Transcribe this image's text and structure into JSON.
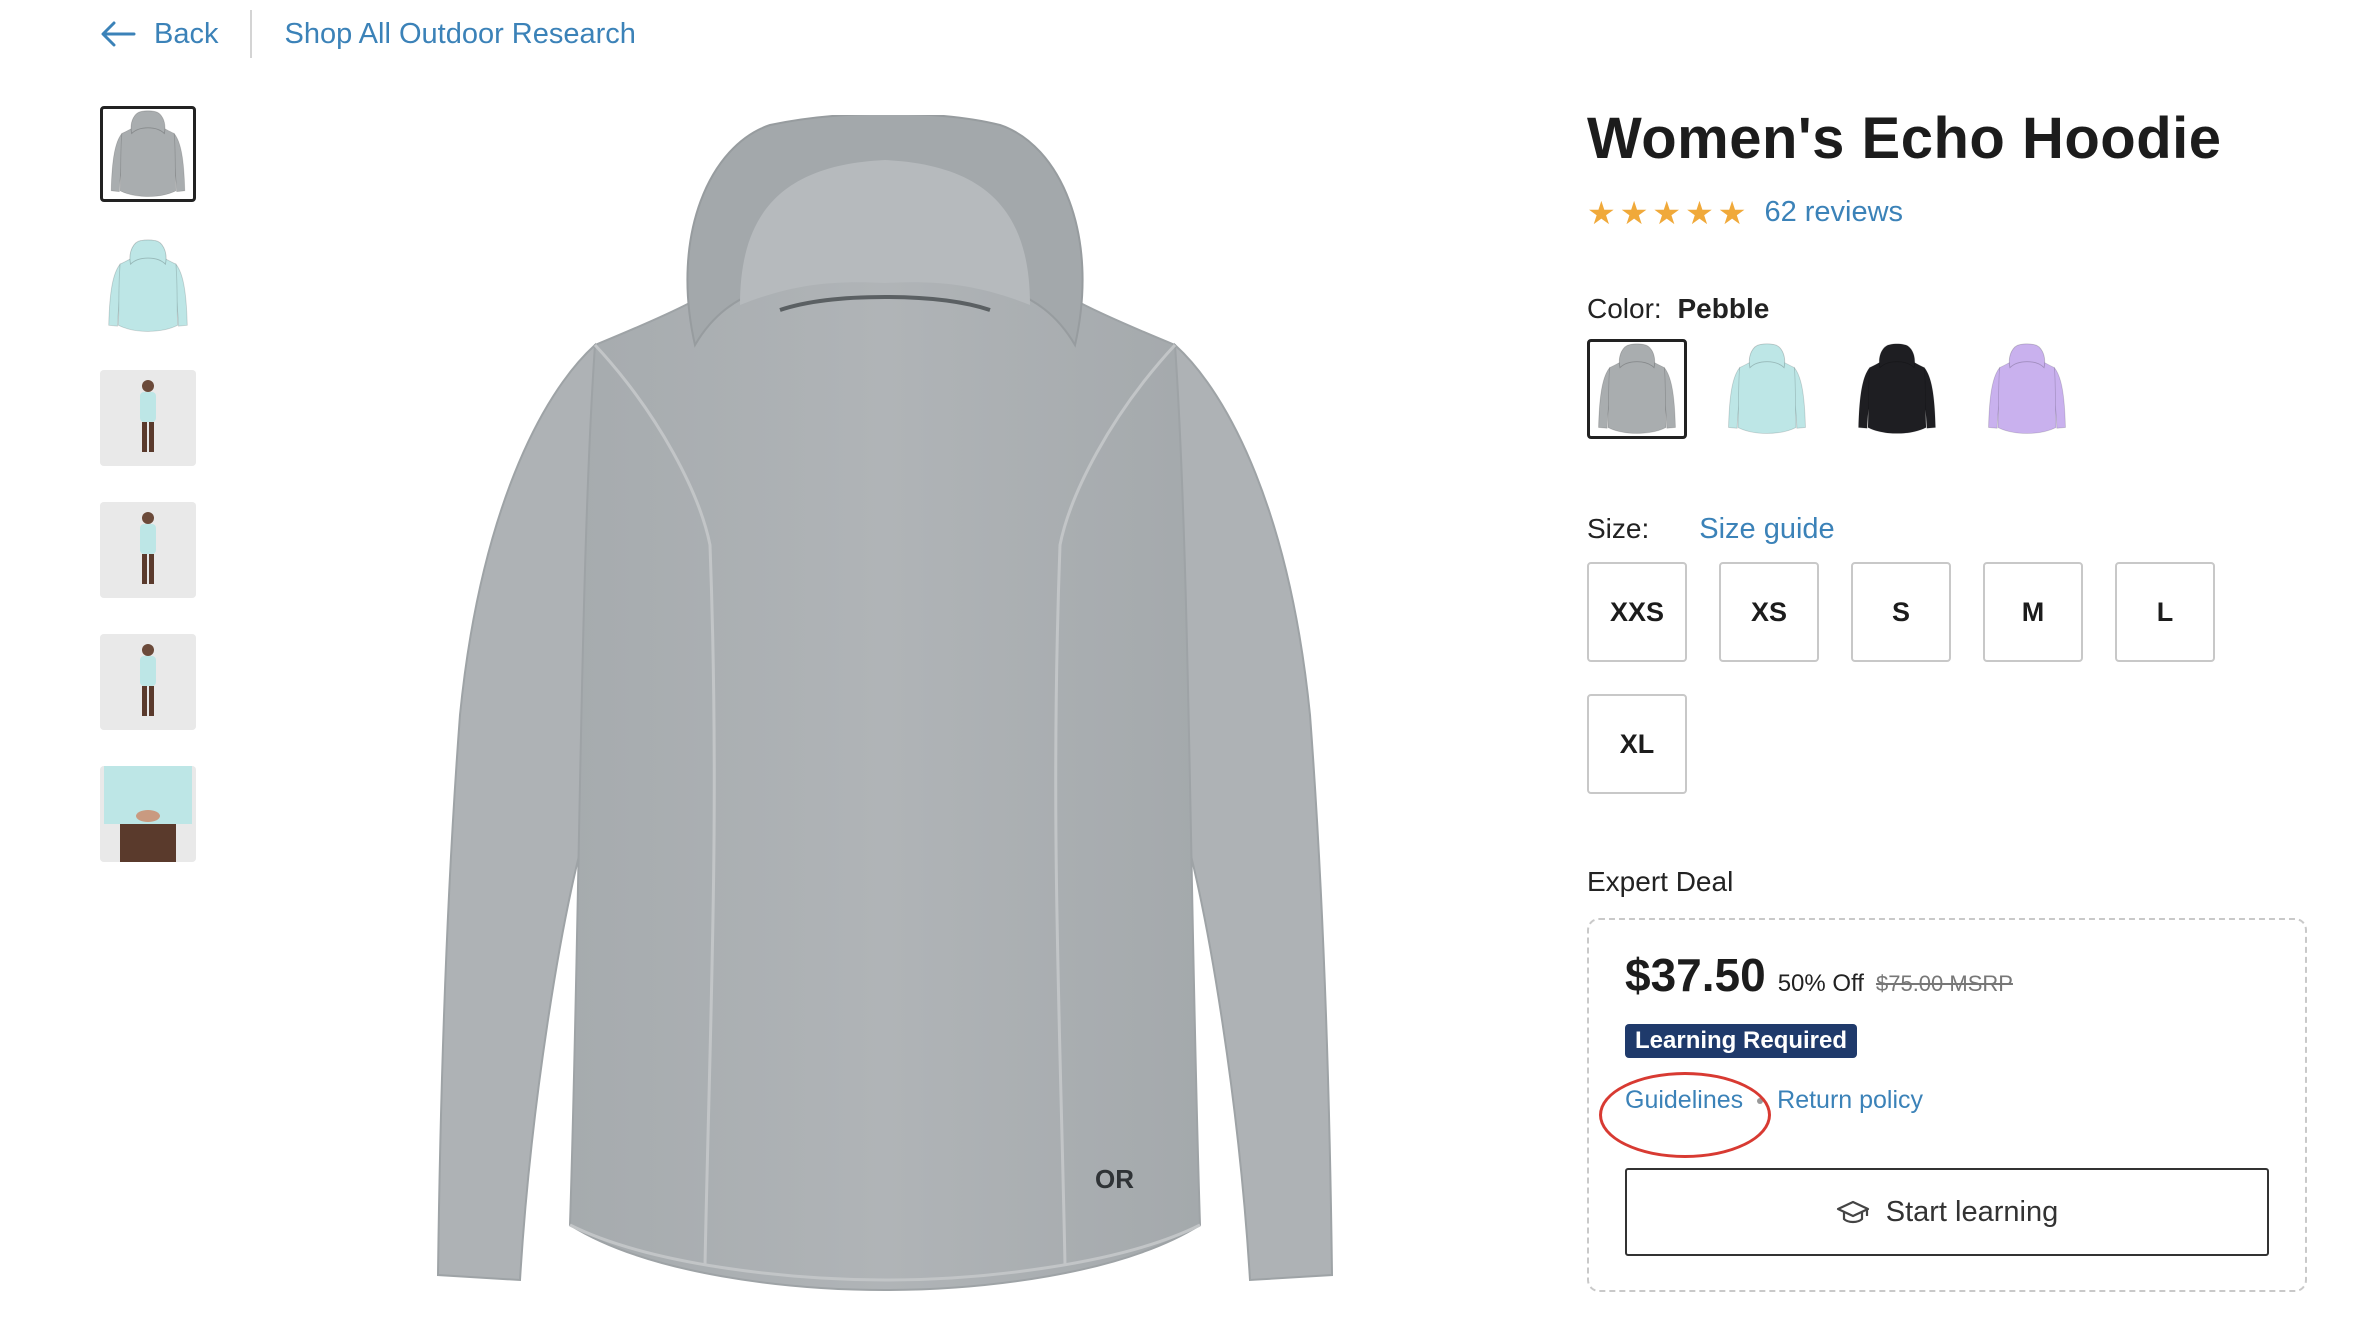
{
  "nav": {
    "back_label": "Back",
    "shop_all_label": "Shop All Outdoor Research"
  },
  "product": {
    "title": "Women's Echo Hoodie",
    "rating_stars": 5,
    "reviews_label": "62 reviews",
    "color_label": "Color:",
    "color_value": "Pebble",
    "swatches": [
      {
        "name": "Pebble",
        "color": "#a9adaf",
        "selected": true
      },
      {
        "name": "Aqua",
        "color": "#bde6e6",
        "selected": false
      },
      {
        "name": "Black",
        "color": "#1e1e22",
        "selected": false
      },
      {
        "name": "Lavender",
        "color": "#c9b1ee",
        "selected": false
      }
    ],
    "size_label": "Size:",
    "size_guide_label": "Size guide",
    "sizes": [
      "XXS",
      "XS",
      "S",
      "M",
      "L",
      "XL"
    ],
    "logo_text": "OR"
  },
  "thumbnails": [
    {
      "kind": "hoodie",
      "color": "#a9adaf",
      "selected": true
    },
    {
      "kind": "hoodie",
      "color": "#bde6e6",
      "selected": false
    },
    {
      "kind": "model-front",
      "color": "#bde6e6",
      "selected": false
    },
    {
      "kind": "model-back",
      "color": "#bde6e6",
      "selected": false
    },
    {
      "kind": "model-side",
      "color": "#bde6e6",
      "selected": false
    },
    {
      "kind": "model-closeup",
      "color": "#bde6e6",
      "selected": false
    }
  ],
  "deal": {
    "section_label": "Expert Deal",
    "price": "$37.50",
    "discount": "50% Off",
    "msrp": "$75.00 MSRP",
    "badge": "Learning Required",
    "guidelines_label": "Guidelines",
    "return_policy_label": "Return policy",
    "start_label": "Start learning"
  },
  "colors": {
    "link": "#3b82b8",
    "star": "#f0a93a",
    "badge_bg": "#1f3a6b",
    "annotation": "#d83a32"
  }
}
